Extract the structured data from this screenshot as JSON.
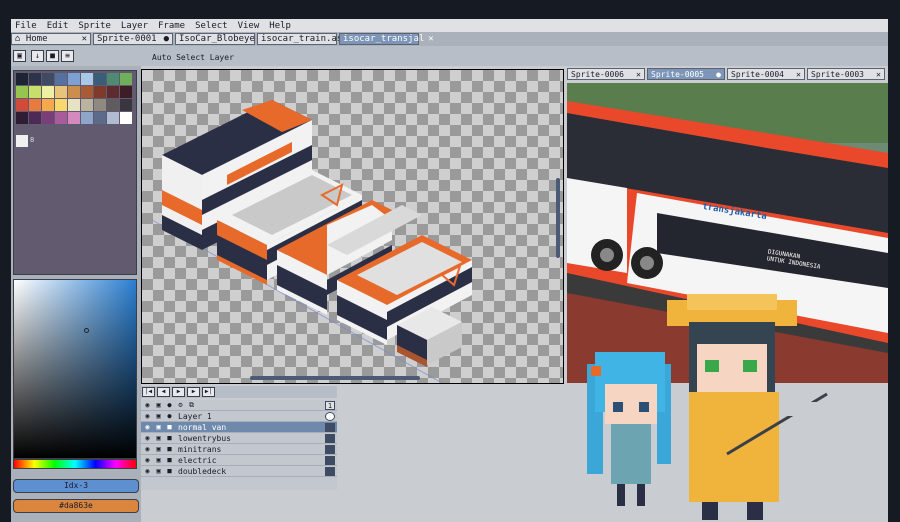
{
  "menu": [
    "File",
    "Edit",
    "Sprite",
    "Layer",
    "Frame",
    "Select",
    "View",
    "Help"
  ],
  "tabs": [
    {
      "label": "Home",
      "icon": "home-icon",
      "active": false
    },
    {
      "label": "Sprite-0001",
      "dot": true,
      "active": false
    },
    {
      "label": "IsoCar_Blobeye",
      "active": false
    },
    {
      "label": "isocar_train.as",
      "active": false
    },
    {
      "label": "isocar_transjal",
      "active": true
    }
  ],
  "toolbar": {
    "context_label": "Auto Select Layer",
    "icons": [
      "lock-icon",
      "down-arrow-icon",
      "square-icon",
      "lines-icon"
    ]
  },
  "palette": [
    "#1e2433",
    "#2d3349",
    "#3f4a63",
    "#5670a0",
    "#7ea0d2",
    "#a8c8e8",
    "#3a5e7a",
    "#4f8a73",
    "#6fae5a",
    "#95c451",
    "#c6de6a",
    "#eef0a4",
    "#e8c37a",
    "#cc8e4c",
    "#a95b36",
    "#7e3b2c",
    "#5e2c30",
    "#3e1e26",
    "#d24a3a",
    "#e97a3f",
    "#f5a94b",
    "#f8d86a",
    "#e7e2c3",
    "#b9b3a0",
    "#8e8a82",
    "#5f5b5e",
    "#3a3640",
    "#2f1d36",
    "#4d2a55",
    "#7a3f78",
    "#a85c9c",
    "#d48abf",
    "#8ea6c9",
    "#5d6b8a",
    "#b0bcd0",
    "#ffffff"
  ],
  "palette_extra": {
    "color": "#f0f0f0",
    "label": "8"
  },
  "color_labels": {
    "main": "Idx-3",
    "secondary": "#da863e",
    "main_color": "#5e8fd1",
    "secondary_color": "#da863e"
  },
  "sprite_tabs": [
    "Sprite-0006",
    "Sprite-0005",
    "Sprite-0004",
    "Sprite-0003"
  ],
  "layers": [
    {
      "name": "",
      "icons": "◉ 🔒 ●● ⚙ ⧉",
      "cel": "1",
      "type": "header"
    },
    {
      "name": "Layer 1",
      "folder": false,
      "selected": false
    },
    {
      "name": "normal van",
      "folder": true,
      "selected": true
    },
    {
      "name": "lowentrybus",
      "folder": true,
      "selected": false
    },
    {
      "name": "minitrans",
      "folder": true,
      "selected": false
    },
    {
      "name": "electric",
      "folder": true,
      "selected": false
    },
    {
      "name": "doubledeck",
      "folder": true,
      "selected": false
    }
  ],
  "reference": {
    "bus_brand": "transjakarta",
    "bus_text": "DIGUNAKAN\nUNTUK INDONESIA"
  }
}
